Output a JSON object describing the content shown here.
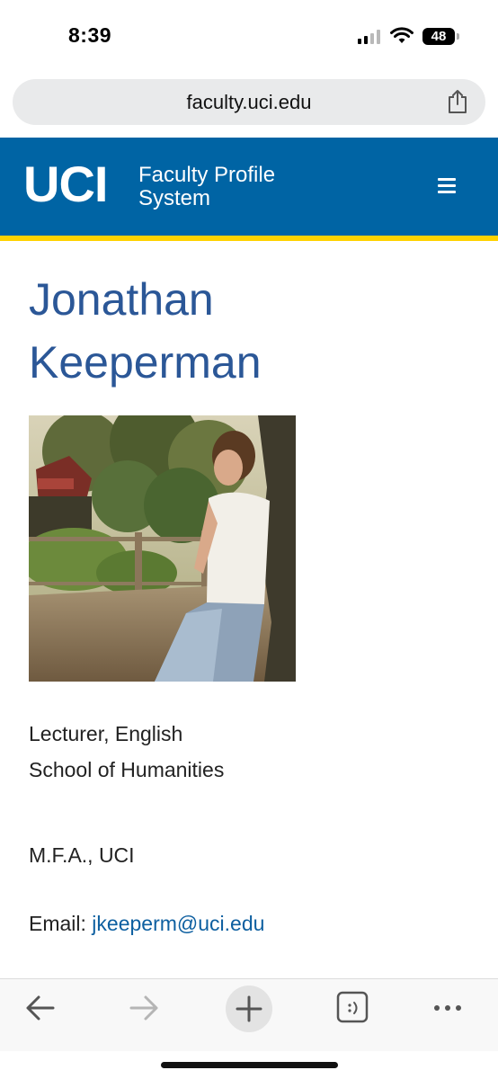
{
  "status_bar": {
    "time": "8:39",
    "battery": "48"
  },
  "browser": {
    "url": "faculty.uci.edu"
  },
  "site_header": {
    "logo": "UCI",
    "title_line1": "Faculty Profile",
    "title_line2": "System"
  },
  "profile": {
    "name_line1": "Jonathan",
    "name_line2": "Keeperman",
    "title": "Lecturer, English",
    "school": "School of Humanities",
    "degree": "M.F.A., UCI",
    "email_label": "Email:",
    "email": "jkeeperm@uci.edu"
  },
  "toolbar": {
    "icons": [
      "back-arrow-icon",
      "forward-arrow-icon",
      "new-tab-plus-icon",
      "tabs-icon",
      "more-icon"
    ]
  },
  "colors": {
    "uci_blue": "#0064a4",
    "uci_gold": "#ffd200",
    "name_blue": "#2b5797",
    "link_blue": "#0d5fa0"
  }
}
